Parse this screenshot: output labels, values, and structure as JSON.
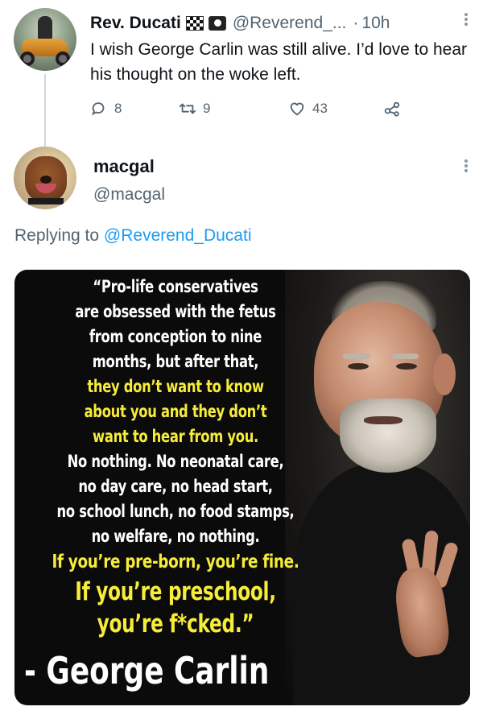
{
  "tweet1": {
    "display_name": "Rev. Ducati",
    "badges": [
      "checkered-flag-icon",
      "skull-flag-icon"
    ],
    "handle": "@Reverend_...",
    "separator": "·",
    "time": "10h",
    "text": "I wish George Carlin was still alive. I’d love to hear his thought on the woke left.",
    "stats": {
      "replies": "8",
      "retweets": "9",
      "likes": "43"
    }
  },
  "tweet2": {
    "display_name": "macgal",
    "handle": "@macgal",
    "replying_prefix": "Replying to",
    "replying_to": "@Reverend_Ducati"
  },
  "image": {
    "quote_lines": [
      {
        "text": "“Pro-life conservatives",
        "style": "w"
      },
      {
        "text": "are obsessed with the fetus",
        "style": "w"
      },
      {
        "text": "from conception to nine",
        "style": "w"
      },
      {
        "text": "months, but after that,",
        "style": "w"
      },
      {
        "text": "they don’t want to know",
        "style": "y"
      },
      {
        "text": "about you and they don’t",
        "style": "y"
      },
      {
        "text": "want to hear from you.",
        "style": "y"
      },
      {
        "text": "No nothing. No neonatal care,",
        "style": "w"
      },
      {
        "text": "no day care, no head start,",
        "style": "w"
      },
      {
        "text": "no school lunch, no food stamps,",
        "style": "w"
      },
      {
        "text": "no welfare, no nothing.",
        "style": "w"
      },
      {
        "text": "If you’re pre-born, you’re fine.",
        "style": "y-lg"
      },
      {
        "text": "If you’re preschool,",
        "style": "y-xl"
      },
      {
        "text": "you’re f*cked.”",
        "style": "y-xl"
      }
    ],
    "attribution": "- George Carlin"
  },
  "colors": {
    "link": "#1d9bf0",
    "secondary_text": "#536471",
    "quote_yellow": "#f6ec3a"
  }
}
